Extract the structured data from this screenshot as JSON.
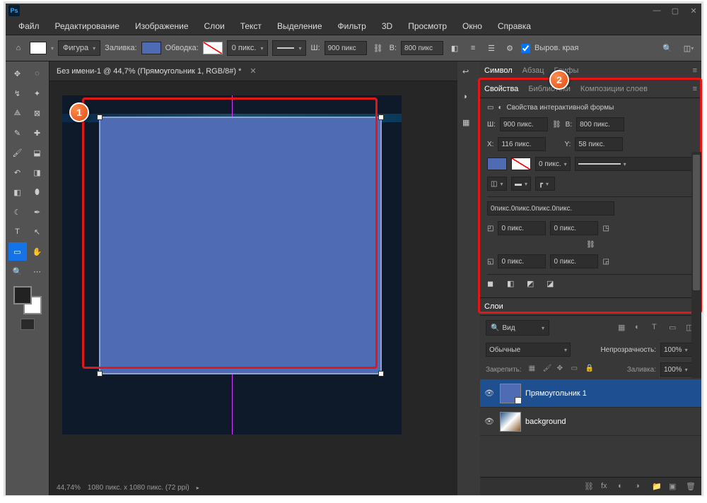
{
  "menubar": [
    "Файл",
    "Редактирование",
    "Изображение",
    "Слои",
    "Текст",
    "Выделение",
    "Фильтр",
    "3D",
    "Просмотр",
    "Окно",
    "Справка"
  ],
  "options": {
    "shape_mode": "Фигура",
    "fill_label": "Заливка:",
    "stroke_label": "Обводка:",
    "stroke_size": "0 пикс.",
    "w_label": "Ш:",
    "w_value": "900 пикс",
    "h_label": "В:",
    "h_value": "800 пикс",
    "align_label": "Выров. края",
    "fill_color": "#4f6bb3",
    "stroke_swatch": "#ffffff"
  },
  "doc_tab": {
    "title": "Без имени-1 @ 44,7% (Прямоугольник 1, RGB/8#) *"
  },
  "statusbar": {
    "zoom": "44,74%",
    "docinfo": "1080 пикс. x 1080 пикс. (72 ppi)"
  },
  "panel_tabs_top": {
    "tabs": [
      "Символ",
      "Абзац",
      "Глифы"
    ],
    "active": 0
  },
  "panel_tabs_props": {
    "tabs": [
      "Свойства",
      "Библиотеки",
      "Композиции слоев"
    ],
    "active": 0
  },
  "properties": {
    "header": "Свойства интерактивной формы",
    "w_label": "Ш:",
    "w_value": "900 пикс.",
    "h_label": "В:",
    "h_value": "800 пикс.",
    "x_label": "X:",
    "x_value": "116 пикс.",
    "y_label": "Y:",
    "y_value": "58 пикс.",
    "stroke_size": "0 пикс.",
    "corners_str": "0пикс.0пикс.0пикс.0пикс.",
    "corner_tl": "0 пикс.",
    "corner_tr": "0 пикс.",
    "corner_bl": "0 пикс.",
    "corner_br": "0 пикс.",
    "fill_color": "#4f6bb3"
  },
  "layers_panel": {
    "tab": "Слои",
    "filter_label": "Вид",
    "blend_mode": "Обычные",
    "opacity_label": "Непрозрачность:",
    "opacity_value": "100%",
    "lock_label": "Закрепить:",
    "fill_label": "Заливка:",
    "fill_value": "100%",
    "layers": [
      {
        "name": "Прямоугольник 1",
        "active": true
      },
      {
        "name": "background",
        "active": false
      }
    ]
  },
  "callouts": {
    "c1": "1",
    "c2": "2"
  }
}
